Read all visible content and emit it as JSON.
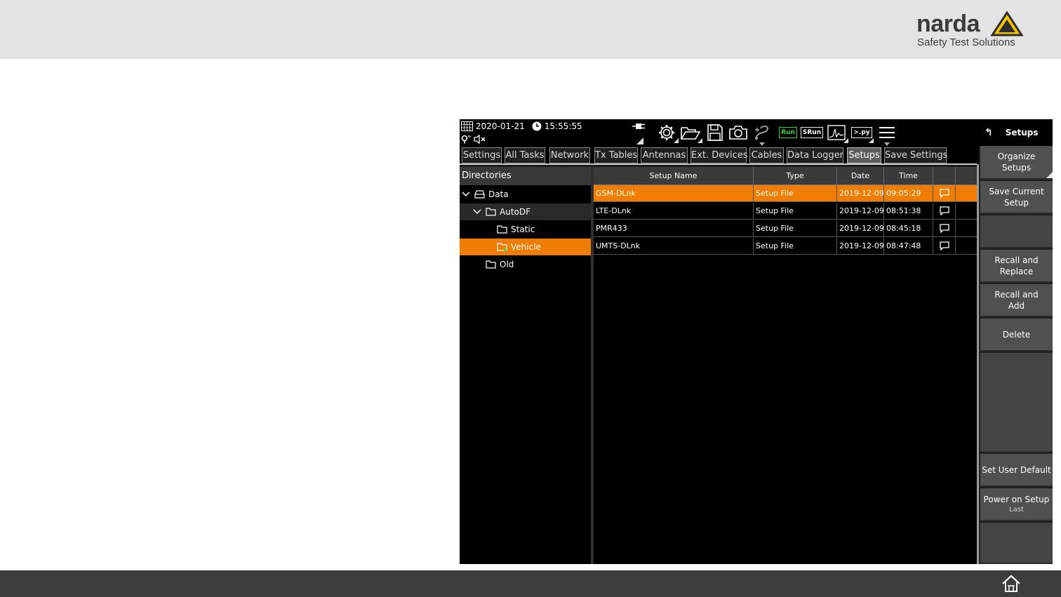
{
  "logo": {
    "brand": "narda",
    "tagline": "Safety Test Solutions"
  },
  "status": {
    "date": "2020-01-21",
    "time": "15:55:55"
  },
  "toolbar": {
    "run_label": "Run",
    "srun_label": "SRun",
    "py_label": ">.py",
    "icons": [
      "settings-gear-icon",
      "open-folder-icon",
      "save-disk-icon",
      "camera-icon",
      "route-icon",
      "run-icon",
      "srun-icon",
      "chart-icon",
      "python-script-icon",
      "hamburger-menu-icon"
    ]
  },
  "menu": {
    "title": "Setups",
    "back_icon": "back-arrow-icon"
  },
  "tabs": [
    {
      "label": "Settings"
    },
    {
      "label": "All Tasks"
    },
    {
      "label": "Network"
    },
    {
      "label": "Tx Tables"
    },
    {
      "label": "Antennas"
    },
    {
      "label": "Ext. Devices"
    },
    {
      "label": "Cables"
    },
    {
      "label": "Data Logger"
    },
    {
      "label": "Setups",
      "active": true
    },
    {
      "label": "Save Settings"
    }
  ],
  "directories": {
    "header": "Directories",
    "items": [
      {
        "label": "Data",
        "icon": "drive-icon",
        "expanded": true
      },
      {
        "label": "AutoDF",
        "icon": "folder-icon",
        "expanded": true
      },
      {
        "label": "Static",
        "icon": "folder-icon"
      },
      {
        "label": "Vehicle",
        "icon": "folder-icon",
        "selected": true
      },
      {
        "label": "Old",
        "icon": "folder-icon"
      }
    ]
  },
  "table": {
    "columns": [
      "Setup Name",
      "Type",
      "Date",
      "Time",
      ""
    ],
    "rows": [
      {
        "name": "GSM-DLnk",
        "type": "Setup File",
        "date": "2019-12-09",
        "time": "09:05:29",
        "selected": true
      },
      {
        "name": "LTE-DLnk",
        "type": "Setup File",
        "date": "2019-12-09",
        "time": "08:51:38"
      },
      {
        "name": "PMR433",
        "type": "Setup File",
        "date": "2019-12-09",
        "time": "08:45:18"
      },
      {
        "name": "UMTS-DLnk",
        "type": "Setup File",
        "date": "2019-12-09",
        "time": "08:47:48"
      }
    ]
  },
  "side_menu": {
    "organize": "Organize Setups",
    "save_current": "Save Current Setup",
    "recall_replace": "Recall and Replace",
    "recall_add": "Recall and Add",
    "delete": "Delete",
    "set_user_default": "Set User Default",
    "power_on": "Power on Setup",
    "power_on_value": "Last"
  },
  "colors": {
    "accent": "#f07d00",
    "run_green": "#39d339",
    "logo_triangle": "#f5c400"
  }
}
